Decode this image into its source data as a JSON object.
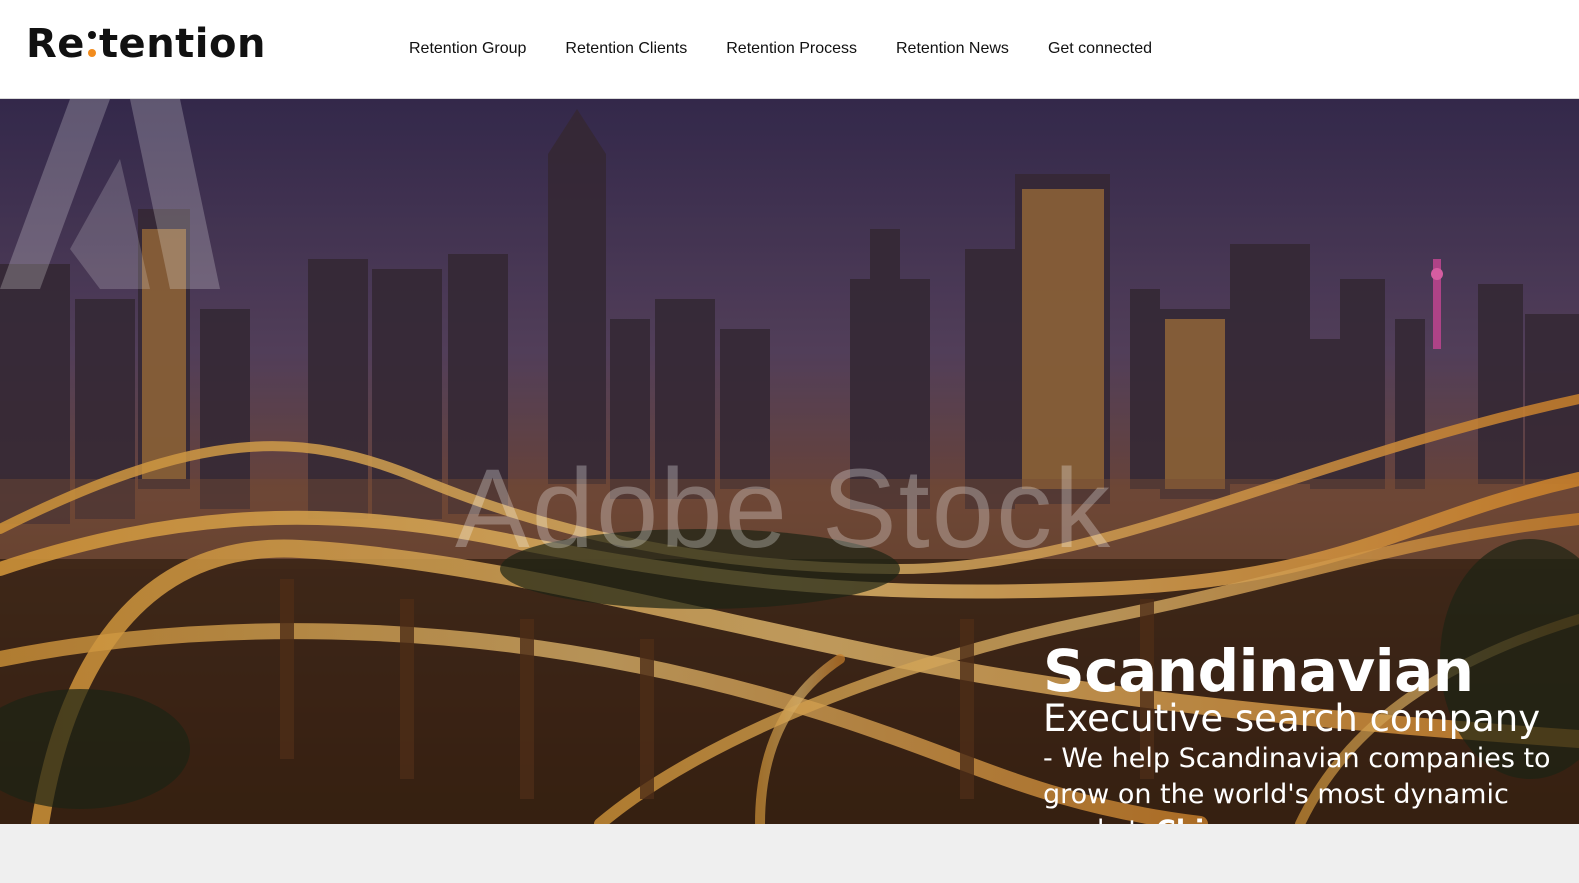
{
  "header": {
    "logo": {
      "before": "Re",
      "after": "tention",
      "colon_accent": "#f28c1e"
    },
    "nav": [
      {
        "label": "Retention Group"
      },
      {
        "label": "Retention Clients"
      },
      {
        "label": "Retention Process"
      },
      {
        "label": "Retention News"
      },
      {
        "label": "Get connected"
      }
    ]
  },
  "hero": {
    "watermark": "Adobe Stock",
    "title": "Scandinavian",
    "subtitle": "Executive search company",
    "description": "- We help Scandinavian companies to grow on the world's most dynamic market,",
    "highlight": "China"
  }
}
